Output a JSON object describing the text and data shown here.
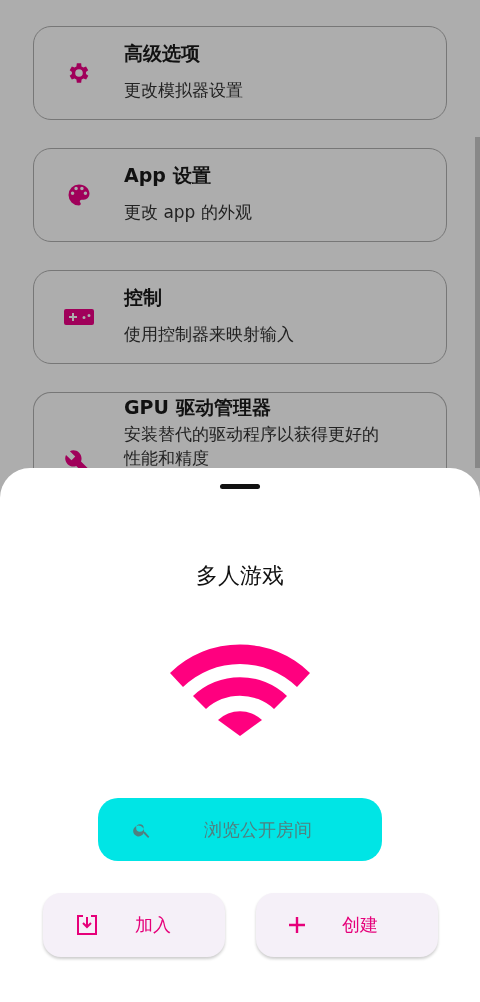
{
  "settings_items": [
    {
      "kind": "gear",
      "title": "高级选项",
      "subtitle": "更改模拟器设置"
    },
    {
      "kind": "palette",
      "title": "App 设置",
      "subtitle": "更改 app 的外观"
    },
    {
      "kind": "gamepad",
      "title": "控制",
      "subtitle": "使用控制器来映射输入"
    },
    {
      "kind": "wrench",
      "title": "GPU 驱动管理器",
      "subtitle": "安装替代的驱动程序以获得更好的性能和精度"
    }
  ],
  "sheet": {
    "title": "多人游戏",
    "browse_button": {
      "label": "浏览公开房间",
      "disabled": true
    },
    "buttons": [
      {
        "kind": "join",
        "label": "加入"
      },
      {
        "kind": "create",
        "label": "创建"
      }
    ]
  }
}
